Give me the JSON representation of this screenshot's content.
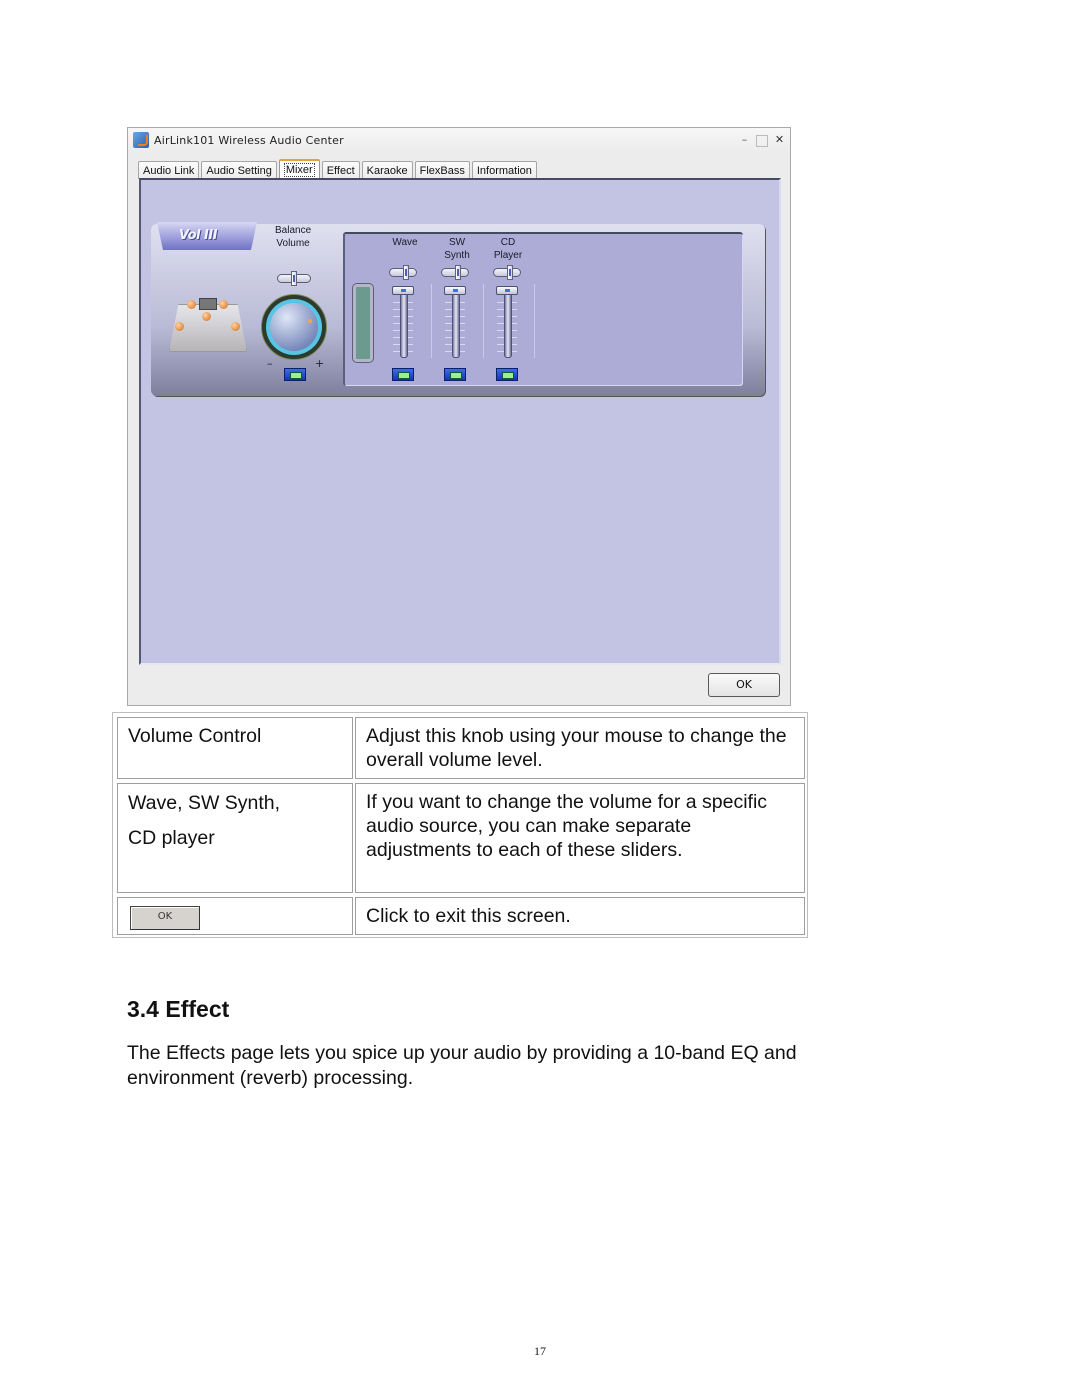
{
  "screenshot": {
    "window": {
      "title": "AirLink101 Wireless Audio Center",
      "icon": "app-icon",
      "controls": {
        "minimize": "–",
        "maximize": "□",
        "close": "✕"
      }
    },
    "tabs": [
      {
        "label": "Audio Link",
        "active": false
      },
      {
        "label": "Audio Setting",
        "active": false
      },
      {
        "label": "Mixer",
        "active": true
      },
      {
        "label": "Effect",
        "active": false
      },
      {
        "label": "Karaoke",
        "active": false
      },
      {
        "label": "FlexBass",
        "active": false
      },
      {
        "label": "Information",
        "active": false
      }
    ],
    "mixer": {
      "badge_label": "Vol III",
      "balance_volume_label": "Balance\nVolume",
      "knob_minus": "–",
      "knob_plus": "+",
      "channels": [
        {
          "label": "Wave",
          "level_percent": 100,
          "balance": "center"
        },
        {
          "label": "SW\nSynth",
          "level_percent": 100,
          "balance": "center"
        },
        {
          "label": "CD\nPlayer",
          "level_percent": 100,
          "balance": "center"
        }
      ]
    },
    "ok_button": "OK"
  },
  "table": {
    "rows": [
      {
        "term": "Volume Control",
        "description": "Adjust this knob using your mouse to change the overall volume level."
      },
      {
        "term": "Wave, SW Synth,\nCD player",
        "description": "If you want to change the volume for a specific audio source, you can make separate adjustments to each of these sliders."
      },
      {
        "term_button": "OK",
        "description": "Click to exit this screen."
      }
    ]
  },
  "section": {
    "heading": "3.4 Effect",
    "paragraph": "The Effects page lets you spice up your audio by providing a 10-band EQ and environment (reverb) processing."
  },
  "page_number": "17"
}
